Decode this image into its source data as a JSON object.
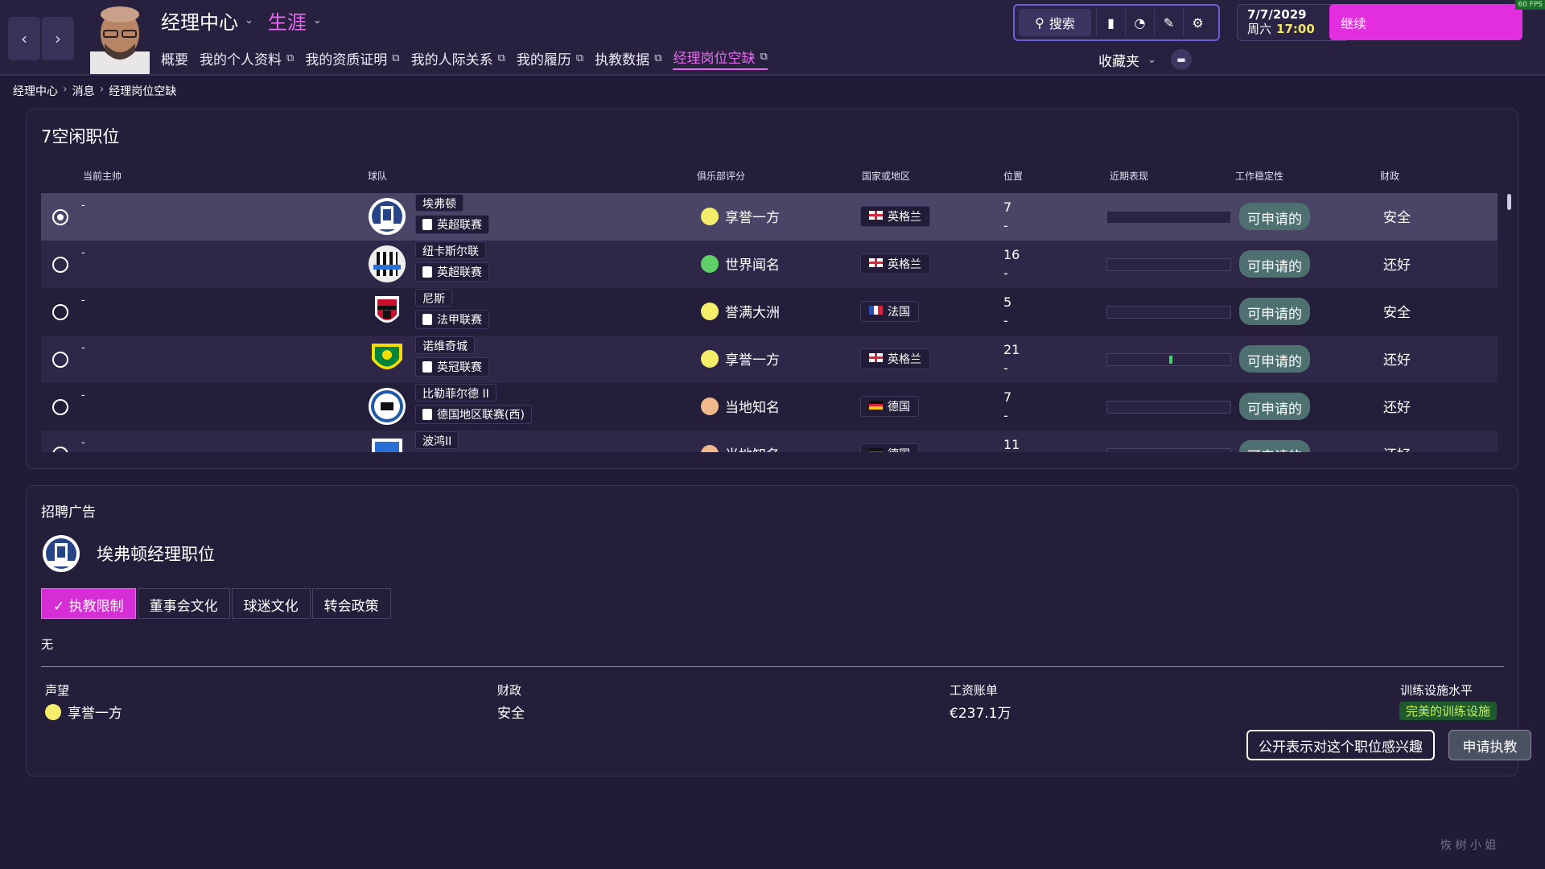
{
  "header": {
    "title": "经理中心",
    "section": "生涯",
    "tabs": [
      {
        "label": "概要",
        "external": false
      },
      {
        "label": "我的个人资料",
        "external": true
      },
      {
        "label": "我的资质证明",
        "external": true
      },
      {
        "label": "我的人际关系",
        "external": true
      },
      {
        "label": "我的履历",
        "external": true
      },
      {
        "label": "执教数据",
        "external": true
      },
      {
        "label": "经理岗位空缺",
        "external": true,
        "active": true
      }
    ],
    "search_label": "搜索",
    "favourites_label": "收藏夹",
    "date": "7/7/2029",
    "weekday": "周六",
    "time": "17:00",
    "continue_label": "继续",
    "fps": "60 FPS"
  },
  "breadcrumb": [
    "经理中心",
    "消息",
    "经理岗位空缺"
  ],
  "vacancies": {
    "title": "7空闲职位",
    "columns": {
      "manager": "当前主帅",
      "club": "球队",
      "reputation": "俱乐部评分",
      "nation": "国家或地区",
      "position": "位置",
      "form": "近期表现",
      "stability": "工作稳定性",
      "finances": "财政"
    },
    "rows": [
      {
        "manager": "-",
        "club": "埃弗顿",
        "league": "英超联赛",
        "reputation": "享誉一方",
        "rep_color": "#f5ee6a",
        "nation": "英格兰",
        "flag": "england",
        "position": "7",
        "position2": "-",
        "form": 0,
        "stability": "可申请的",
        "finances": "安全",
        "selected": true
      },
      {
        "manager": "-",
        "club": "纽卡斯尔联",
        "league": "英超联赛",
        "reputation": "世界闻名",
        "rep_color": "#5fd068",
        "nation": "英格兰",
        "flag": "england",
        "position": "16",
        "position2": "-",
        "form": 0,
        "stability": "可申请的",
        "finances": "还好"
      },
      {
        "manager": "-",
        "club": "尼斯",
        "league": "法甲联赛",
        "reputation": "誉满大洲",
        "rep_color": "#f5ee6a",
        "nation": "法国",
        "flag": "france",
        "position": "5",
        "position2": "-",
        "form": 0,
        "stability": "可申请的",
        "finances": "安全"
      },
      {
        "manager": "-",
        "club": "诺维奇城",
        "league": "英冠联赛",
        "reputation": "享誉一方",
        "rep_color": "#f5ee6a",
        "nation": "英格兰",
        "flag": "england",
        "position": "21",
        "position2": "-",
        "form": 0.5,
        "stability": "可申请的",
        "finances": "还好"
      },
      {
        "manager": "-",
        "club": "比勒菲尔德 II",
        "league": "德国地区联赛(西)",
        "reputation": "当地知名",
        "rep_color": "#f1b98b",
        "nation": "德国",
        "flag": "germany",
        "position": "7",
        "position2": "-",
        "form": 0,
        "stability": "可申请的",
        "finances": "还好"
      },
      {
        "manager": "-",
        "club": "波鸿II",
        "league": "",
        "reputation": "当地知名",
        "rep_color": "#f1b98b",
        "nation": "德国",
        "flag": "germany",
        "position": "11",
        "position2": "",
        "form": 0,
        "stability": "可申请的",
        "finances": "还好"
      }
    ]
  },
  "advert": {
    "heading": "招聘广告",
    "job_title": "埃弗顿经理职位",
    "tabs": [
      "执教限制",
      "董事会文化",
      "球迷文化",
      "转会政策"
    ],
    "active_tab": "执教限制",
    "restriction_text": "无",
    "stats": {
      "reputation_label": "声望",
      "reputation_value": "享誉一方",
      "finances_label": "财政",
      "finances_value": "安全",
      "wages_label": "工资账单",
      "wages_value": "€237.1万",
      "training_label": "训练设施水平",
      "training_value": "完美的训练设施"
    },
    "btn_interest": "公开表示对这个职位感兴趣",
    "btn_apply": "申请执教"
  },
  "watermark": "恢 树 小 姐"
}
